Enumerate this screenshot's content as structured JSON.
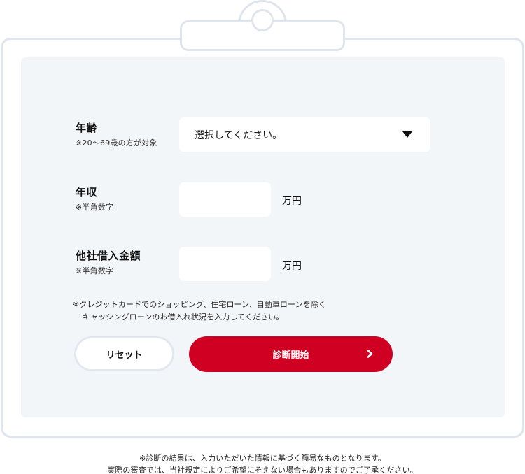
{
  "form": {
    "age": {
      "label": "年齢",
      "note": "※20〜69歳の方が対象",
      "selected": "選択してください。"
    },
    "income": {
      "label": "年収",
      "note": "※半角数字",
      "value": "",
      "unit": "万円"
    },
    "other_loans": {
      "label": "他社借入金額",
      "note": "※半角数字",
      "value": "",
      "unit": "万円"
    },
    "loan_note_line1": "※クレジットカードでのショッピング、住宅ローン、自動車ローンを除く",
    "loan_note_line2": "キャッシングローンのお借入れ状況を入力してください。"
  },
  "buttons": {
    "reset_label": "リセット",
    "start_label": "診断開始"
  },
  "footer": {
    "line1": "※診断の結果は、入力いただいた情報に基づく簡易なものとなります。",
    "line2": "実際の審査では、当社規定によりご希望にそえない場合もありますのでご了承ください。"
  },
  "icons": {
    "select_arrow": "caret-down-icon",
    "start_arrow": "chevron-right-icon"
  },
  "colors": {
    "accent": "#d00022",
    "panel": "#f3f6f9",
    "frame": "#dfe5ec"
  }
}
